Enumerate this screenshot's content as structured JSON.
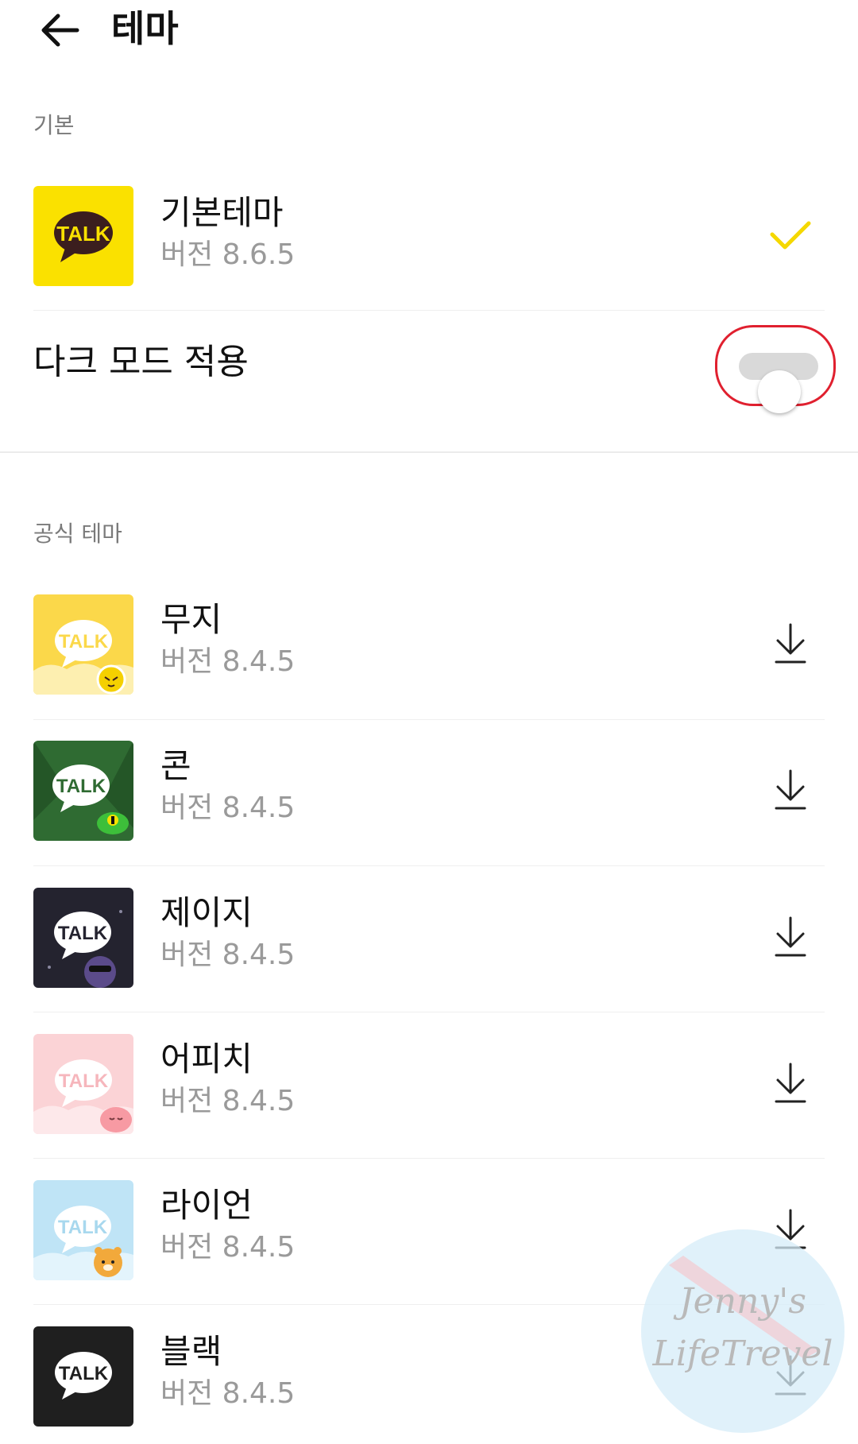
{
  "header": {
    "title": "테마"
  },
  "sections": {
    "basic_label": "기본",
    "official_label": "공식 테마"
  },
  "default_theme": {
    "name": "기본테마",
    "version": "버전 8.6.5",
    "selected": true
  },
  "dark_mode": {
    "label": "다크 모드 적용",
    "enabled": false
  },
  "themes": [
    {
      "name": "무지",
      "version": "버전 8.4.5"
    },
    {
      "name": "콘",
      "version": "버전 8.4.5"
    },
    {
      "name": "제이지",
      "version": "버전 8.4.5"
    },
    {
      "name": "어피치",
      "version": "버전 8.4.5"
    },
    {
      "name": "라이언",
      "version": "버전 8.4.5"
    },
    {
      "name": "블랙",
      "version": "버전 8.4.5"
    }
  ],
  "icons": {
    "talk_badge": "TALK"
  },
  "watermark": {
    "line1": "Jenny's",
    "line2": "LifeTrevel"
  },
  "colors": {
    "kakao_yellow": "#fae100",
    "check_yellow": "#f5d800",
    "highlight_red": "#e0202f"
  }
}
